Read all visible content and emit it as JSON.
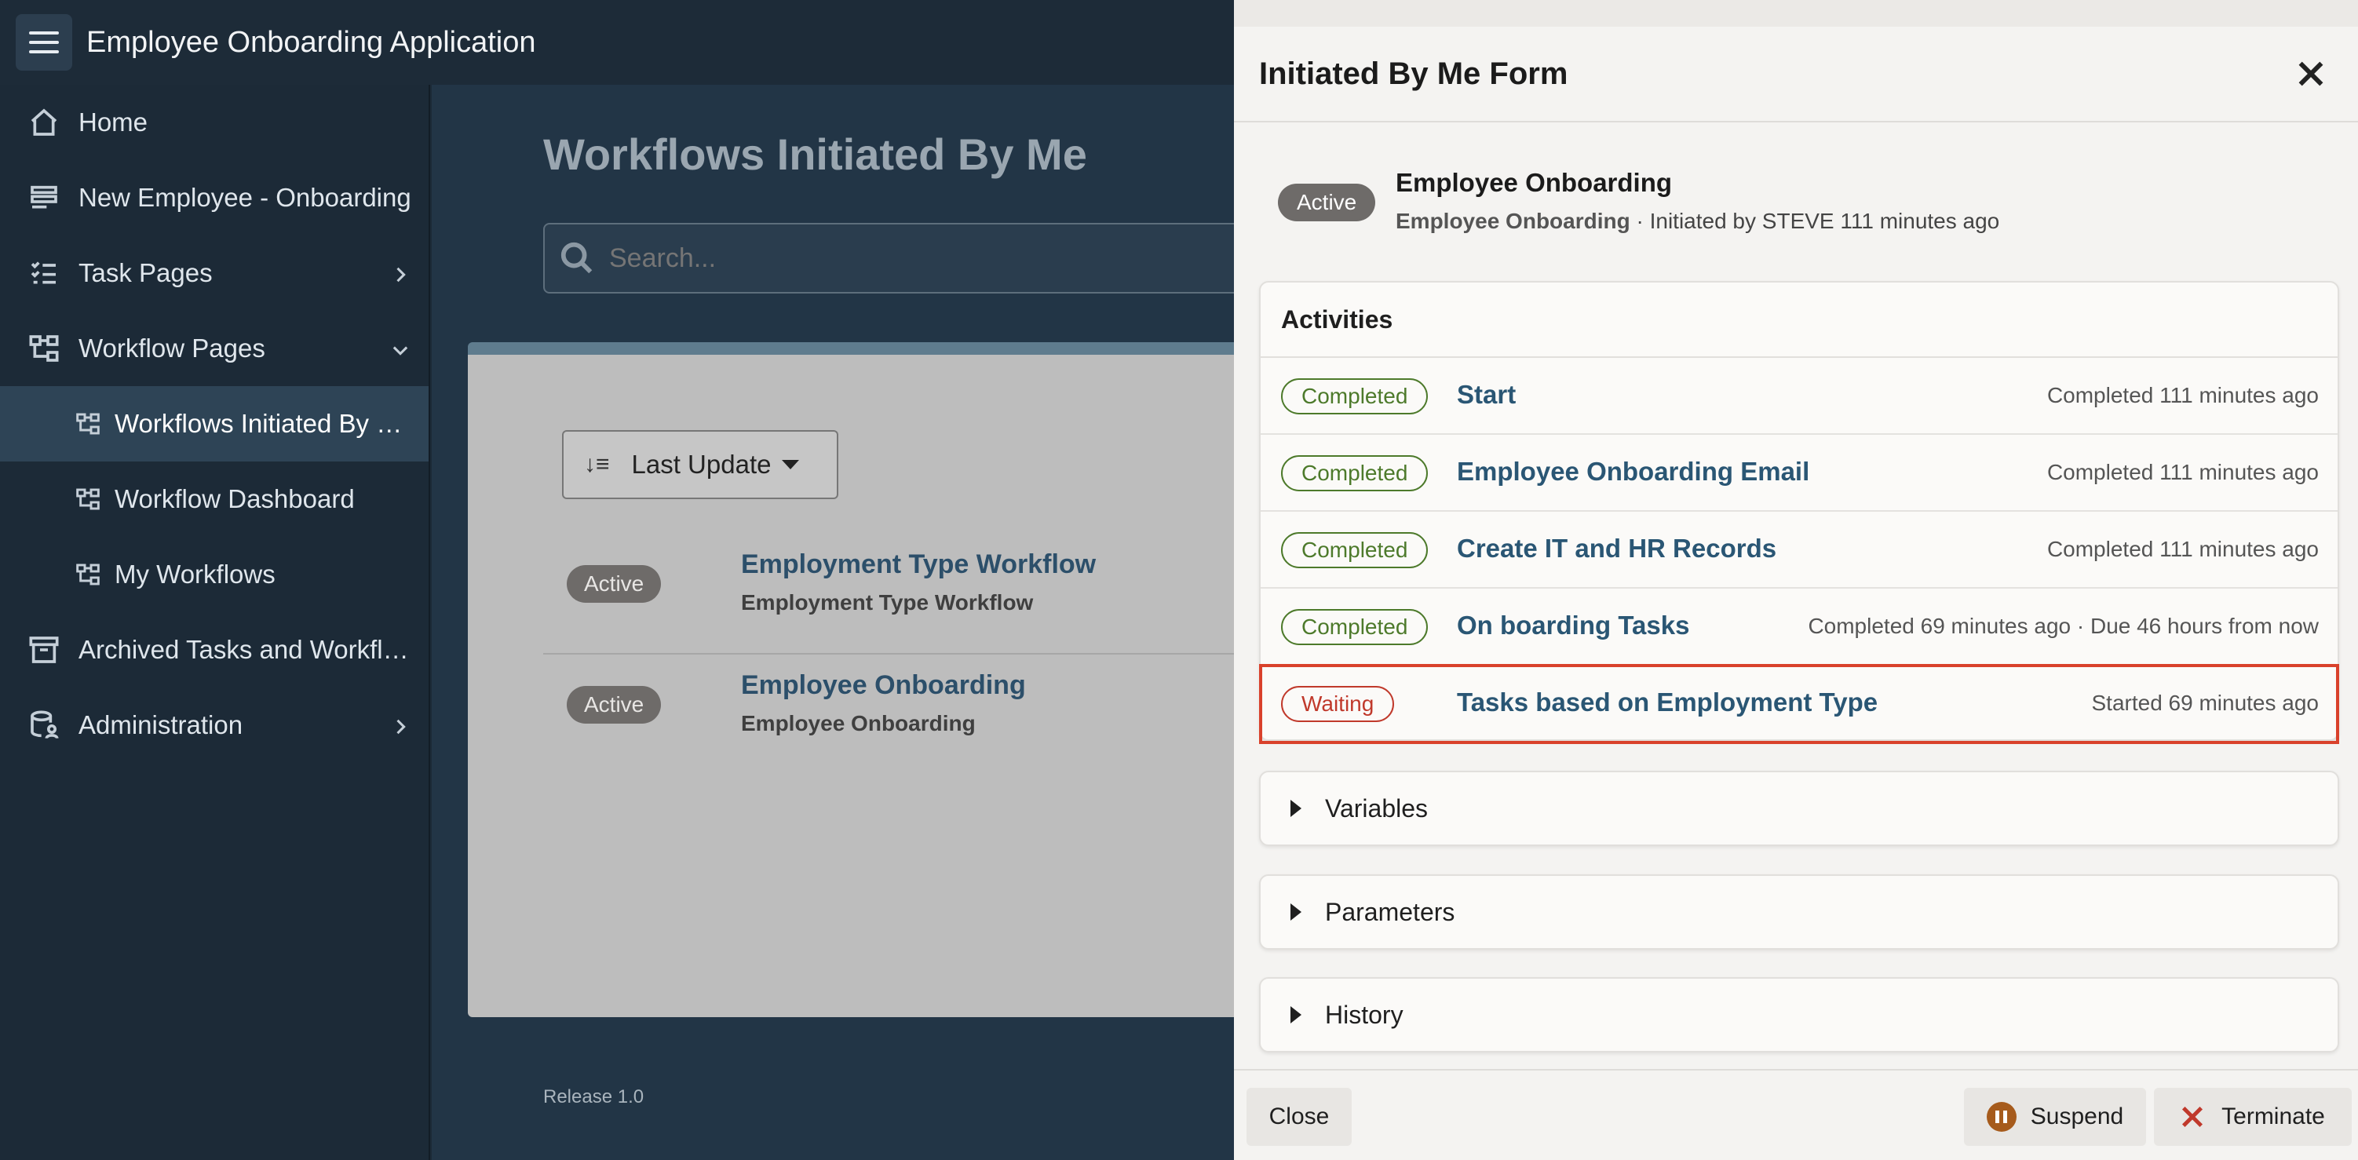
{
  "app": {
    "title": "Employee Onboarding Application"
  },
  "sidebar": {
    "items": [
      {
        "label": "Home",
        "icon": "home-icon"
      },
      {
        "label": "New Employee - Onboarding",
        "icon": "form-icon"
      },
      {
        "label": "Task Pages",
        "icon": "task-list-icon"
      },
      {
        "label": "Workflow Pages",
        "icon": "workflow-icon"
      },
      {
        "label": "Workflows Initiated By Me",
        "icon": "workflow-icon"
      },
      {
        "label": "Workflow Dashboard",
        "icon": "workflow-icon"
      },
      {
        "label": "My Workflows",
        "icon": "workflow-icon"
      },
      {
        "label": "Archived Tasks and Workflows",
        "icon": "archive-icon"
      },
      {
        "label": "Administration",
        "icon": "admin-icon"
      }
    ]
  },
  "main": {
    "title": "Workflows Initiated By Me",
    "search_placeholder": "Search...",
    "sort_label": "Last Update",
    "workflows": [
      {
        "status": "Active",
        "title": "Employment Type Workflow",
        "subtitle": "Employment Type Workflow"
      },
      {
        "status": "Active",
        "title": "Employee Onboarding",
        "subtitle": "Employee Onboarding"
      }
    ],
    "release": "Release 1.0"
  },
  "drawer": {
    "title": "Initiated By Me Form",
    "summary": {
      "status": "Active",
      "title": "Employee Onboarding",
      "subtitle_bold": "Employee Onboarding",
      "subtitle_rest": " · Initiated by STEVE 111 minutes ago"
    },
    "activities": {
      "heading": "Activities",
      "rows": [
        {
          "state": "Completed",
          "name": "Start",
          "status": "Completed 111 minutes ago"
        },
        {
          "state": "Completed",
          "name": "Employee Onboarding Email",
          "status": "Completed 111 minutes ago"
        },
        {
          "state": "Completed",
          "name": "Create IT and HR Records",
          "status": "Completed 111 minutes ago"
        },
        {
          "state": "Completed",
          "name": "On boarding Tasks",
          "status": "Completed 69 minutes ago · Due 46 hours from now"
        },
        {
          "state": "Waiting",
          "name": "Tasks based on Employment Type",
          "status": "Started 69 minutes ago"
        }
      ]
    },
    "sections": {
      "variables": "Variables",
      "parameters": "Parameters",
      "history": "History"
    },
    "footer": {
      "close": "Close",
      "suspend": "Suspend",
      "terminate": "Terminate"
    },
    "colors": {
      "waiting": "#c0392b",
      "completed": "#4d7a2b",
      "link": "#2a5674",
      "highlight": "#d9412b"
    }
  }
}
